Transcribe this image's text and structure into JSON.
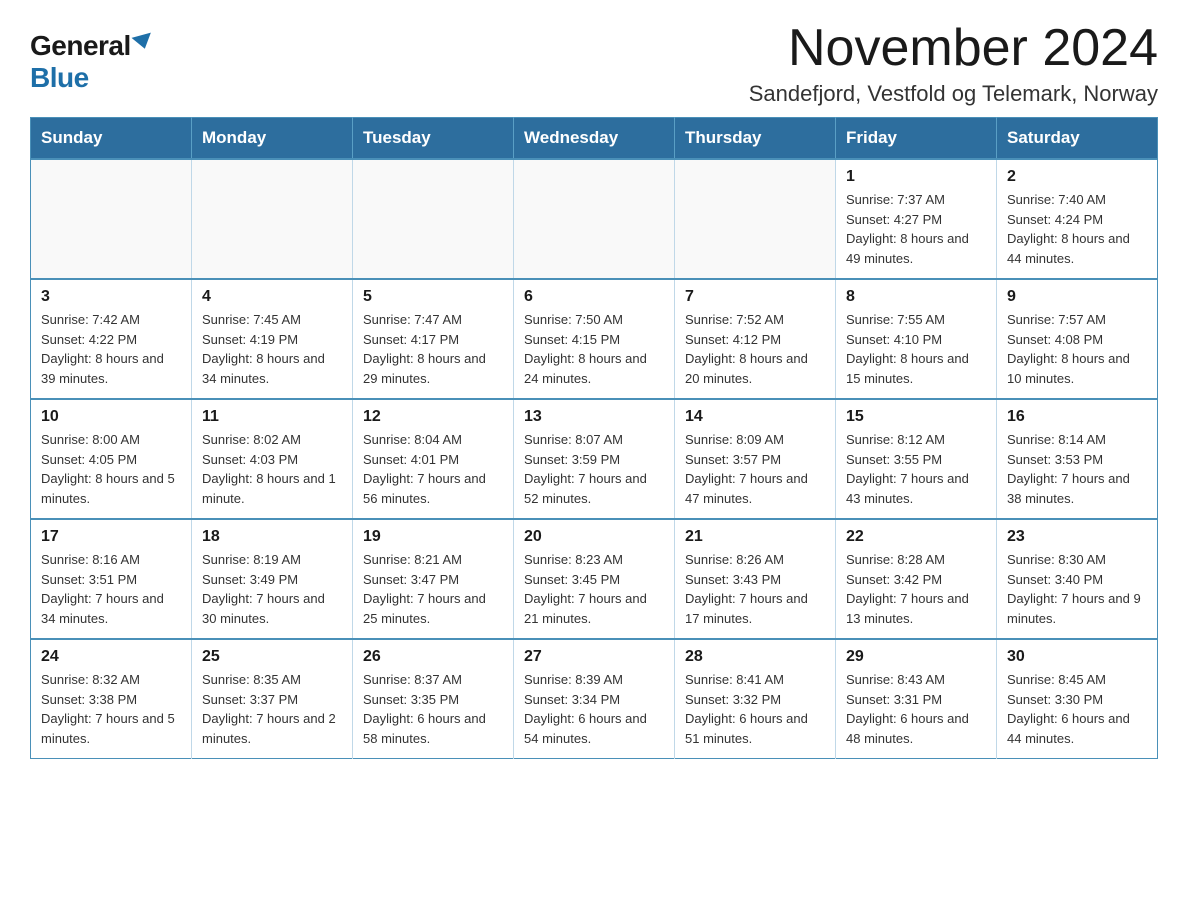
{
  "logo": {
    "general": "General",
    "blue": "Blue"
  },
  "title": "November 2024",
  "subtitle": "Sandefjord, Vestfold og Telemark, Norway",
  "days_of_week": [
    "Sunday",
    "Monday",
    "Tuesday",
    "Wednesday",
    "Thursday",
    "Friday",
    "Saturday"
  ],
  "weeks": [
    [
      {
        "day": "",
        "info": ""
      },
      {
        "day": "",
        "info": ""
      },
      {
        "day": "",
        "info": ""
      },
      {
        "day": "",
        "info": ""
      },
      {
        "day": "",
        "info": ""
      },
      {
        "day": "1",
        "info": "Sunrise: 7:37 AM\nSunset: 4:27 PM\nDaylight: 8 hours and 49 minutes."
      },
      {
        "day": "2",
        "info": "Sunrise: 7:40 AM\nSunset: 4:24 PM\nDaylight: 8 hours and 44 minutes."
      }
    ],
    [
      {
        "day": "3",
        "info": "Sunrise: 7:42 AM\nSunset: 4:22 PM\nDaylight: 8 hours and 39 minutes."
      },
      {
        "day": "4",
        "info": "Sunrise: 7:45 AM\nSunset: 4:19 PM\nDaylight: 8 hours and 34 minutes."
      },
      {
        "day": "5",
        "info": "Sunrise: 7:47 AM\nSunset: 4:17 PM\nDaylight: 8 hours and 29 minutes."
      },
      {
        "day": "6",
        "info": "Sunrise: 7:50 AM\nSunset: 4:15 PM\nDaylight: 8 hours and 24 minutes."
      },
      {
        "day": "7",
        "info": "Sunrise: 7:52 AM\nSunset: 4:12 PM\nDaylight: 8 hours and 20 minutes."
      },
      {
        "day": "8",
        "info": "Sunrise: 7:55 AM\nSunset: 4:10 PM\nDaylight: 8 hours and 15 minutes."
      },
      {
        "day": "9",
        "info": "Sunrise: 7:57 AM\nSunset: 4:08 PM\nDaylight: 8 hours and 10 minutes."
      }
    ],
    [
      {
        "day": "10",
        "info": "Sunrise: 8:00 AM\nSunset: 4:05 PM\nDaylight: 8 hours and 5 minutes."
      },
      {
        "day": "11",
        "info": "Sunrise: 8:02 AM\nSunset: 4:03 PM\nDaylight: 8 hours and 1 minute."
      },
      {
        "day": "12",
        "info": "Sunrise: 8:04 AM\nSunset: 4:01 PM\nDaylight: 7 hours and 56 minutes."
      },
      {
        "day": "13",
        "info": "Sunrise: 8:07 AM\nSunset: 3:59 PM\nDaylight: 7 hours and 52 minutes."
      },
      {
        "day": "14",
        "info": "Sunrise: 8:09 AM\nSunset: 3:57 PM\nDaylight: 7 hours and 47 minutes."
      },
      {
        "day": "15",
        "info": "Sunrise: 8:12 AM\nSunset: 3:55 PM\nDaylight: 7 hours and 43 minutes."
      },
      {
        "day": "16",
        "info": "Sunrise: 8:14 AM\nSunset: 3:53 PM\nDaylight: 7 hours and 38 minutes."
      }
    ],
    [
      {
        "day": "17",
        "info": "Sunrise: 8:16 AM\nSunset: 3:51 PM\nDaylight: 7 hours and 34 minutes."
      },
      {
        "day": "18",
        "info": "Sunrise: 8:19 AM\nSunset: 3:49 PM\nDaylight: 7 hours and 30 minutes."
      },
      {
        "day": "19",
        "info": "Sunrise: 8:21 AM\nSunset: 3:47 PM\nDaylight: 7 hours and 25 minutes."
      },
      {
        "day": "20",
        "info": "Sunrise: 8:23 AM\nSunset: 3:45 PM\nDaylight: 7 hours and 21 minutes."
      },
      {
        "day": "21",
        "info": "Sunrise: 8:26 AM\nSunset: 3:43 PM\nDaylight: 7 hours and 17 minutes."
      },
      {
        "day": "22",
        "info": "Sunrise: 8:28 AM\nSunset: 3:42 PM\nDaylight: 7 hours and 13 minutes."
      },
      {
        "day": "23",
        "info": "Sunrise: 8:30 AM\nSunset: 3:40 PM\nDaylight: 7 hours and 9 minutes."
      }
    ],
    [
      {
        "day": "24",
        "info": "Sunrise: 8:32 AM\nSunset: 3:38 PM\nDaylight: 7 hours and 5 minutes."
      },
      {
        "day": "25",
        "info": "Sunrise: 8:35 AM\nSunset: 3:37 PM\nDaylight: 7 hours and 2 minutes."
      },
      {
        "day": "26",
        "info": "Sunrise: 8:37 AM\nSunset: 3:35 PM\nDaylight: 6 hours and 58 minutes."
      },
      {
        "day": "27",
        "info": "Sunrise: 8:39 AM\nSunset: 3:34 PM\nDaylight: 6 hours and 54 minutes."
      },
      {
        "day": "28",
        "info": "Sunrise: 8:41 AM\nSunset: 3:32 PM\nDaylight: 6 hours and 51 minutes."
      },
      {
        "day": "29",
        "info": "Sunrise: 8:43 AM\nSunset: 3:31 PM\nDaylight: 6 hours and 48 minutes."
      },
      {
        "day": "30",
        "info": "Sunrise: 8:45 AM\nSunset: 3:30 PM\nDaylight: 6 hours and 44 minutes."
      }
    ]
  ]
}
